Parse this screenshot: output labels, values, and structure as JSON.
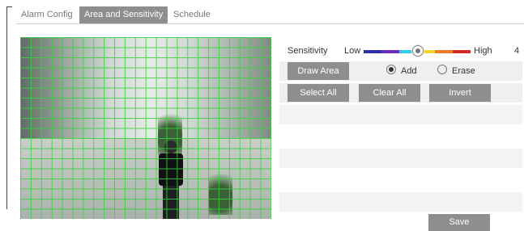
{
  "tabs": [
    "Alarm Config",
    "Area and Sensitivity",
    "Schedule"
  ],
  "sensitivity": {
    "label": "Sensitivity",
    "low": "Low",
    "high": "High",
    "value": "4",
    "slider_level": 0.5,
    "colors": [
      "#2f2da8",
      "#6a2fbf",
      "#2fd0ea",
      "#f2d52b",
      "#ef7b2a",
      "#d62a2a"
    ]
  },
  "buttons": {
    "draw_area": "Draw Area",
    "select_all": "Select All",
    "clear_all": "Clear All",
    "invert": "Invert",
    "save": "Save"
  },
  "radios": {
    "add": "Add",
    "erase": "Erase",
    "selected": "add"
  }
}
